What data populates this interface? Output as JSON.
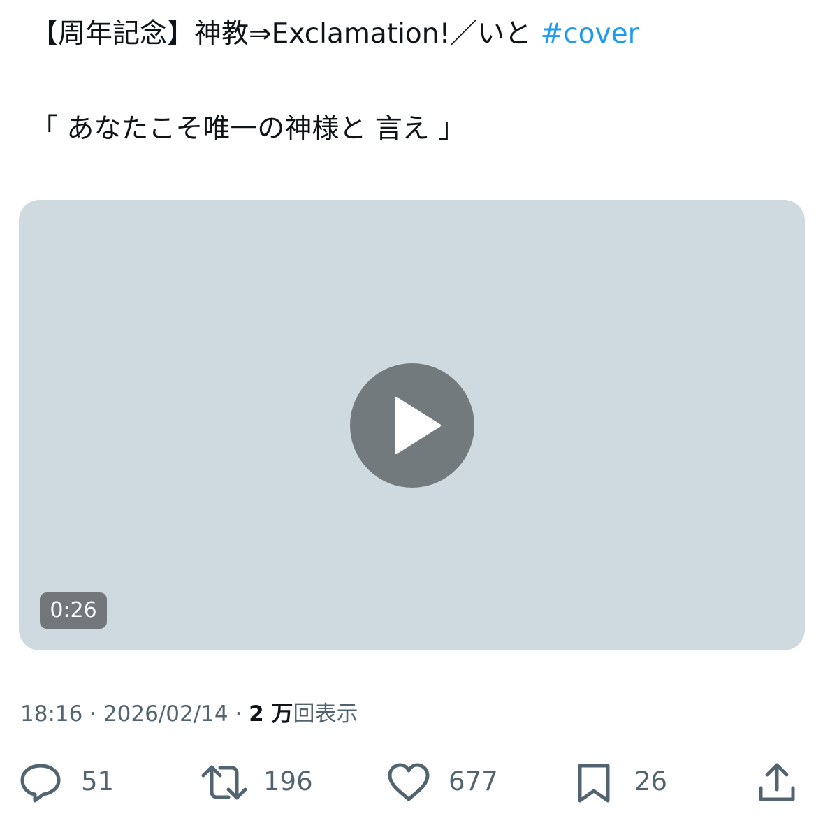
{
  "tweet": {
    "text_line1_prefix": "【周年記念】神教⇒Exclamation!／いと ",
    "hashtag": "#cover",
    "text_line2": "「 あなたこそ唯一の神様と 言え 」"
  },
  "media": {
    "duration": "0:26",
    "play_icon": "play-icon"
  },
  "meta": {
    "time": "18:16",
    "separator1": " · ",
    "date": "2026/02/14",
    "separator2": " · ",
    "view_count": "2 万",
    "view_label": "回表示"
  },
  "actions": {
    "reply": {
      "icon": "reply-icon",
      "count": "51"
    },
    "retweet": {
      "icon": "retweet-icon",
      "count": "196"
    },
    "like": {
      "icon": "heart-icon",
      "count": "677"
    },
    "bookmark": {
      "icon": "bookmark-icon",
      "count": "26"
    },
    "share": {
      "icon": "share-icon"
    }
  },
  "colors": {
    "text": "#0f1419",
    "secondary": "#536471",
    "link": "#1d9bf0",
    "media_bg": "#cfd9e0",
    "play_bg": "#737a7e"
  }
}
